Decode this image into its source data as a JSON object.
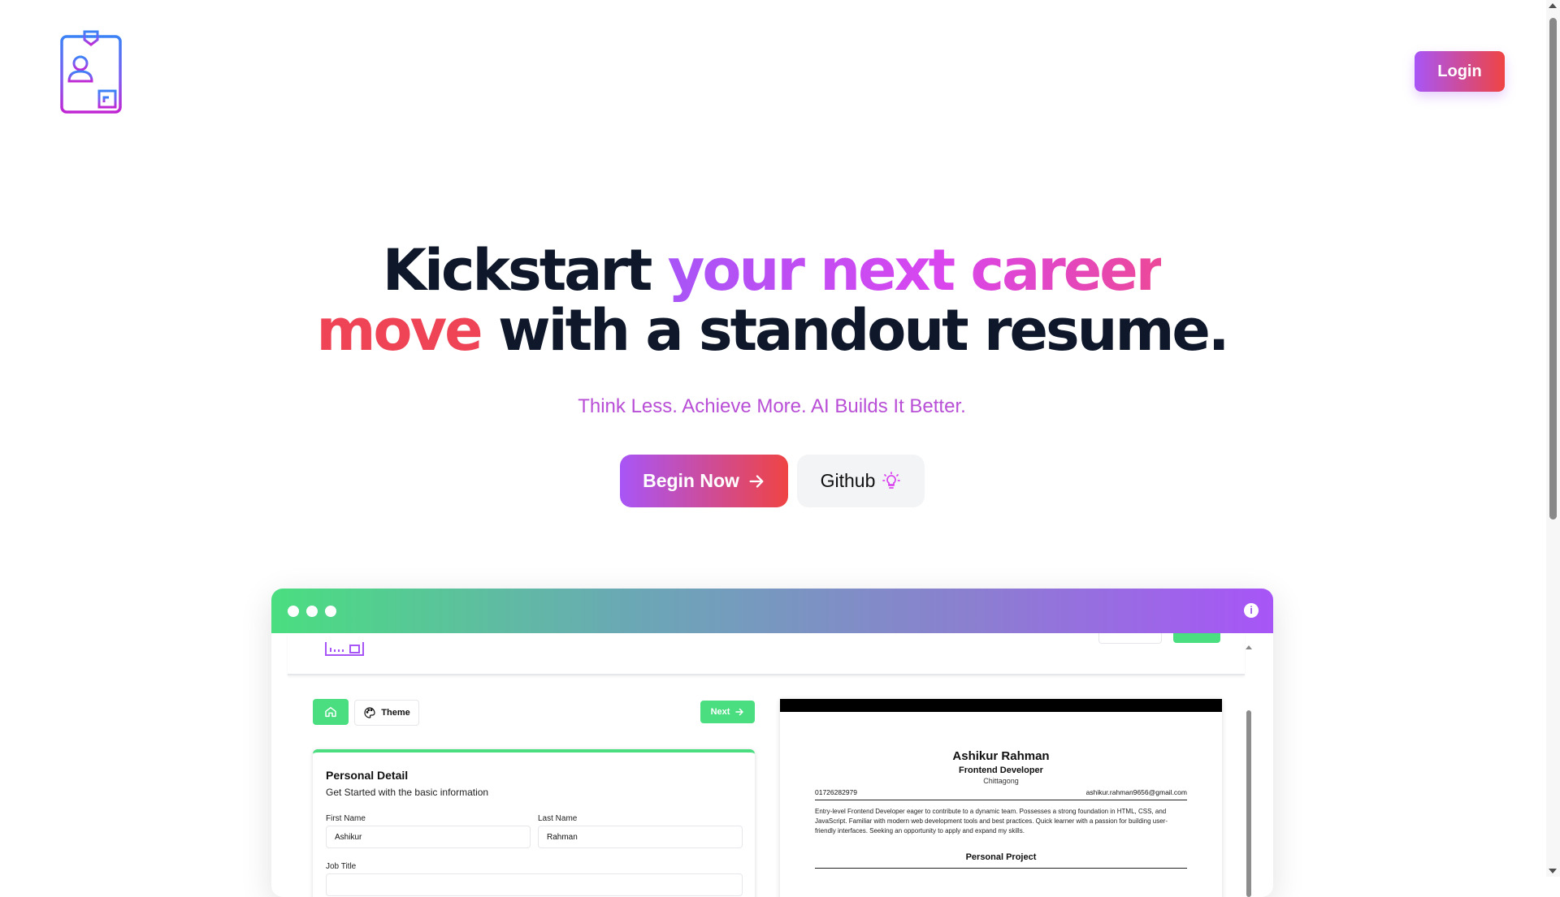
{
  "header": {
    "logo_icon": "resume-id-badge-icon",
    "login_label": "Login"
  },
  "hero": {
    "title_part1": "Kickstart ",
    "title_highlight1": "your next career",
    "title_highlight2": "move",
    "title_part2": " with a standout resume.",
    "tagline": "Think Less. Achieve More. AI Builds It Better.",
    "begin_label": "Begin Now",
    "begin_icon": "arrow-right-icon",
    "github_label": "Github",
    "github_icon": "lightbulb-icon"
  },
  "colors": {
    "accent_purple": "#a855f7",
    "accent_red": "#ef4444",
    "accent_green": "#4ade80",
    "text_dark": "#0f172a"
  },
  "preview": {
    "info_icon": "info-icon",
    "toolbar": {
      "home_icon": "home-icon",
      "theme_label": "Theme",
      "theme_icon": "palette-icon",
      "next_label": "Next"
    },
    "form": {
      "title": "Personal Detail",
      "subtitle": "Get Started with the basic information",
      "first_name_label": "First Name",
      "first_name_value": "Ashikur",
      "last_name_label": "Last Name",
      "last_name_value": "Rahman",
      "job_title_label": "Job Title"
    },
    "resume": {
      "name": "Ashikur Rahman",
      "role": "Frontend Developer",
      "location": "Chittagong",
      "phone": "01726282979",
      "email": "ashikur.rahman9656@gmail.com",
      "summary": "Entry-level Frontend Developer eager to contribute to a dynamic team. Possesses a strong foundation in HTML, CSS, and JavaScript. Familiar with modern web development tools and best practices. Quick learner with a passion for building user-friendly interfaces. Seeking an opportunity to apply and expand my skills.",
      "section_title": "Personal Project"
    }
  }
}
